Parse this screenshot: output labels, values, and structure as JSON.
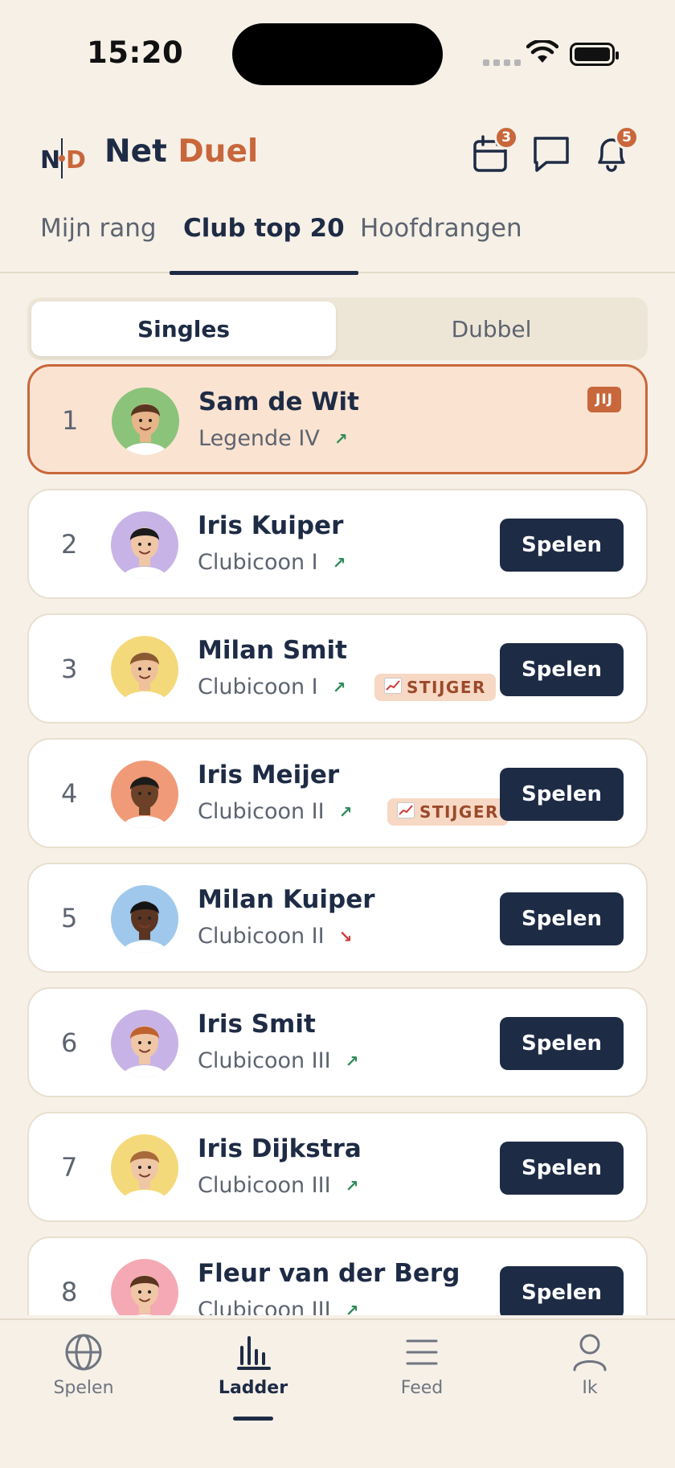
{
  "status_bar": {
    "time": "15:20"
  },
  "app": {
    "logo_letters": "ND",
    "brand_part1": "Net",
    "brand_part2": "Duel",
    "icons": [
      {
        "name": "calendar-icon",
        "badge": "3"
      },
      {
        "name": "chat-icon",
        "badge": ""
      },
      {
        "name": "bell-icon",
        "badge": "5"
      }
    ]
  },
  "tabs": [
    {
      "label": "Mijn rang",
      "active": false
    },
    {
      "label": "Club top 20",
      "active": true
    },
    {
      "label": "Hoofdrangen",
      "active": false
    }
  ],
  "segment": [
    {
      "label": "Singles",
      "active": true
    },
    {
      "label": "Dubbel",
      "active": false
    }
  ],
  "players": [
    {
      "rank": "1",
      "name": "Sam de Wit",
      "tier": "Legende IV",
      "trend": "up",
      "tag": "",
      "me": true,
      "me_label": "JIJ",
      "avatar_bg": "#8bc37a",
      "skin": "#e8b48a",
      "hair": "#5a3620"
    },
    {
      "rank": "2",
      "name": "Iris Kuiper",
      "tier": "Clubicoon I",
      "trend": "up",
      "tag": "",
      "me": false,
      "action": "Spelen",
      "avatar_bg": "#c8b3e6",
      "skin": "#f0c7a6",
      "hair": "#1b1b1b"
    },
    {
      "rank": "3",
      "name": "Milan Smit",
      "tier": "Clubicoon I",
      "trend": "up",
      "tag": "STIJGER",
      "me": false,
      "action": "Spelen",
      "avatar_bg": "#f4d97a",
      "skin": "#eec19b",
      "hair": "#8a5a32"
    },
    {
      "rank": "4",
      "name": "Iris Meijer",
      "tier": "Clubicoon II",
      "trend": "up",
      "tag": "STIJGER",
      "me": false,
      "action": "Spelen",
      "avatar_bg": "#f09a78",
      "skin": "#6b4128",
      "hair": "#1b1b1b"
    },
    {
      "rank": "5",
      "name": "Milan Kuiper",
      "tier": "Clubicoon II",
      "trend": "down",
      "tag": "",
      "me": false,
      "action": "Spelen",
      "avatar_bg": "#9fc8ec",
      "skin": "#5b3522",
      "hair": "#141414"
    },
    {
      "rank": "6",
      "name": "Iris Smit",
      "tier": "Clubicoon III",
      "trend": "up",
      "tag": "",
      "me": false,
      "action": "Spelen",
      "avatar_bg": "#c8b3e6",
      "skin": "#f0c7a6",
      "hair": "#c0622e"
    },
    {
      "rank": "7",
      "name": "Iris Dijkstra",
      "tier": "Clubicoon III",
      "trend": "up",
      "tag": "",
      "me": false,
      "action": "Spelen",
      "avatar_bg": "#f4d97a",
      "skin": "#f0c7a6",
      "hair": "#a86a3a"
    },
    {
      "rank": "8",
      "name": "Fleur van der Berg",
      "tier": "Clubicoon III",
      "trend": "up",
      "tag": "",
      "me": false,
      "action": "Spelen",
      "avatar_bg": "#f4a9b4",
      "skin": "#f0c7a6",
      "hair": "#5a3620"
    }
  ],
  "bottom_nav": [
    {
      "label": "Spelen",
      "icon": "globe-icon",
      "active": false
    },
    {
      "label": "Ladder",
      "icon": "bar-chart-icon",
      "active": true
    },
    {
      "label": "Feed",
      "icon": "menu-lines-icon",
      "active": false
    },
    {
      "label": "Ik",
      "icon": "user-icon",
      "active": false
    }
  ]
}
